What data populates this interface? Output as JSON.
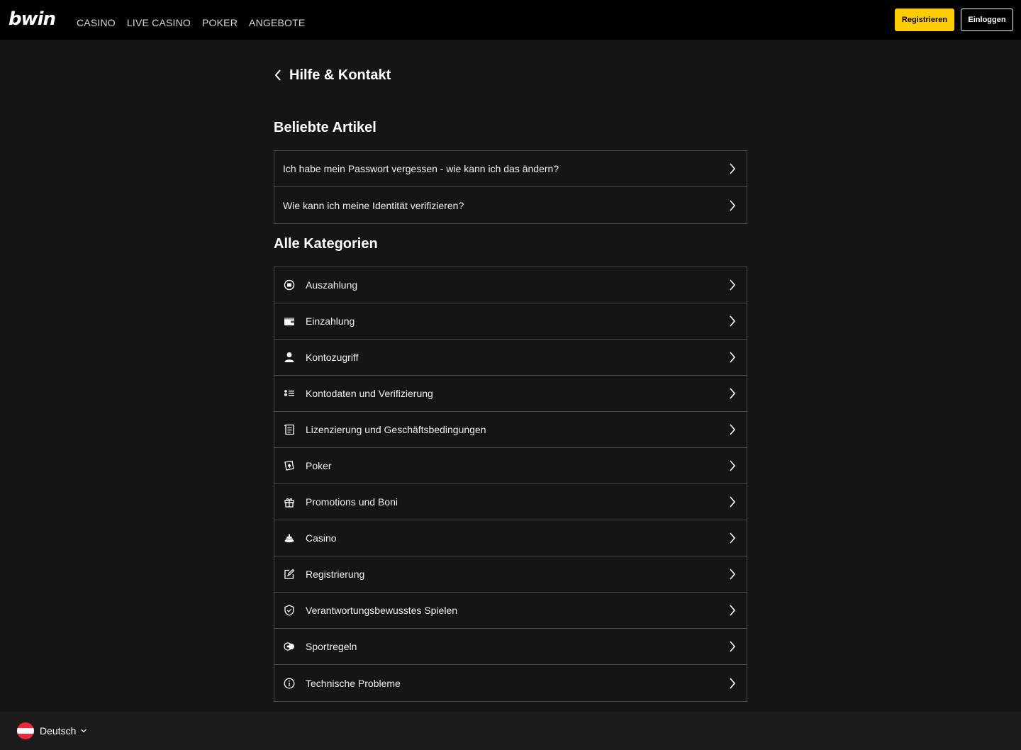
{
  "header": {
    "logo": "bwin",
    "nav": [
      "CASINO",
      "LIVE CASINO",
      "POKER",
      "ANGEBOTE"
    ],
    "register_label": "Registrieren",
    "login_label": "Einloggen",
    "accent_color": "#ffcc00"
  },
  "page": {
    "title": "Hilfe & Kontakt"
  },
  "popular": {
    "title": "Beliebte Artikel",
    "items": [
      "Ich habe mein Passwort vergessen - wie kann ich das ändern?",
      "Wie kann ich meine Identität verifizieren?"
    ]
  },
  "categories": {
    "title": "Alle Kategorien",
    "items": [
      {
        "label": "Auszahlung",
        "icon": "withdrawal-icon"
      },
      {
        "label": "Einzahlung",
        "icon": "wallet-icon"
      },
      {
        "label": "Kontozugriff",
        "icon": "user-icon"
      },
      {
        "label": "Kontodaten und Verifizierung",
        "icon": "details-list-icon"
      },
      {
        "label": "Lizenzierung und Geschäftsbedingungen",
        "icon": "document-icon"
      },
      {
        "label": "Poker",
        "icon": "poker-icon"
      },
      {
        "label": "Promotions und Boni",
        "icon": "gift-icon"
      },
      {
        "label": "Casino",
        "icon": "casino-chips-icon"
      },
      {
        "label": "Registrierung",
        "icon": "edit-icon"
      },
      {
        "label": "Verantwortungsbewusstes Spielen",
        "icon": "shield-icon"
      },
      {
        "label": "Sportregeln",
        "icon": "sports-icon"
      },
      {
        "label": "Technische Probleme",
        "icon": "info-icon"
      }
    ]
  },
  "footer": {
    "language": "Deutsch",
    "flag_icon": "austria-flag-icon"
  }
}
